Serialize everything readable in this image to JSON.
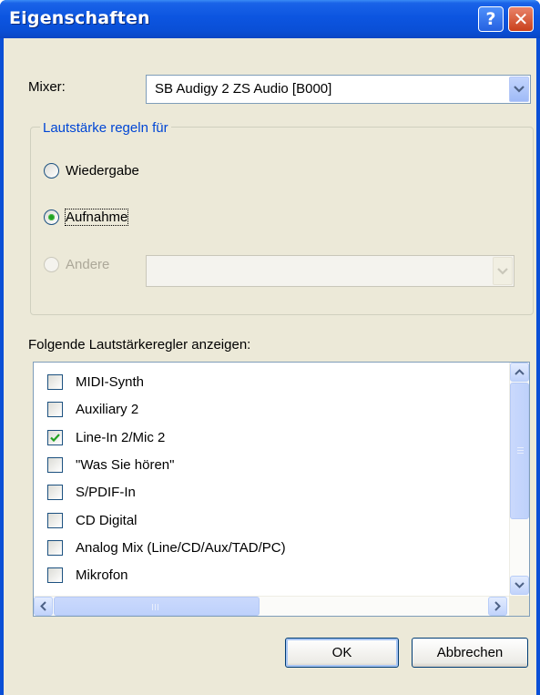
{
  "window": {
    "title": "Eigenschaften",
    "help_glyph": "?",
    "close_glyph": "✕"
  },
  "mixer": {
    "label": "Mixer:",
    "value": "SB Audigy 2 ZS Audio [B000]"
  },
  "volume_group": {
    "legend": "Lautstärke regeln für",
    "options": [
      {
        "label": "Wiedergabe",
        "selected": false,
        "enabled": true
      },
      {
        "label": "Aufnahme",
        "selected": true,
        "enabled": true
      },
      {
        "label": "Andere",
        "selected": false,
        "enabled": false
      }
    ],
    "other_value": ""
  },
  "controls_list": {
    "label": "Folgende Lautstärkeregler anzeigen:",
    "items": [
      {
        "label": "MIDI-Synth",
        "checked": false
      },
      {
        "label": "Auxiliary 2",
        "checked": false
      },
      {
        "label": "Line-In 2/Mic 2",
        "checked": true
      },
      {
        "label": "\"Was Sie hören\"",
        "checked": false
      },
      {
        "label": "S/PDIF-In",
        "checked": false
      },
      {
        "label": "CD Digital",
        "checked": false
      },
      {
        "label": "Analog Mix (Line/CD/Aux/TAD/PC)",
        "checked": false
      },
      {
        "label": "Mikrofon",
        "checked": false
      }
    ]
  },
  "buttons": {
    "ok": "OK",
    "cancel": "Abbrechen"
  },
  "colors": {
    "titlebar": "#0a4fd6",
    "client": "#ece9d8",
    "accent_text": "#0046d5",
    "check": "#21a121"
  }
}
